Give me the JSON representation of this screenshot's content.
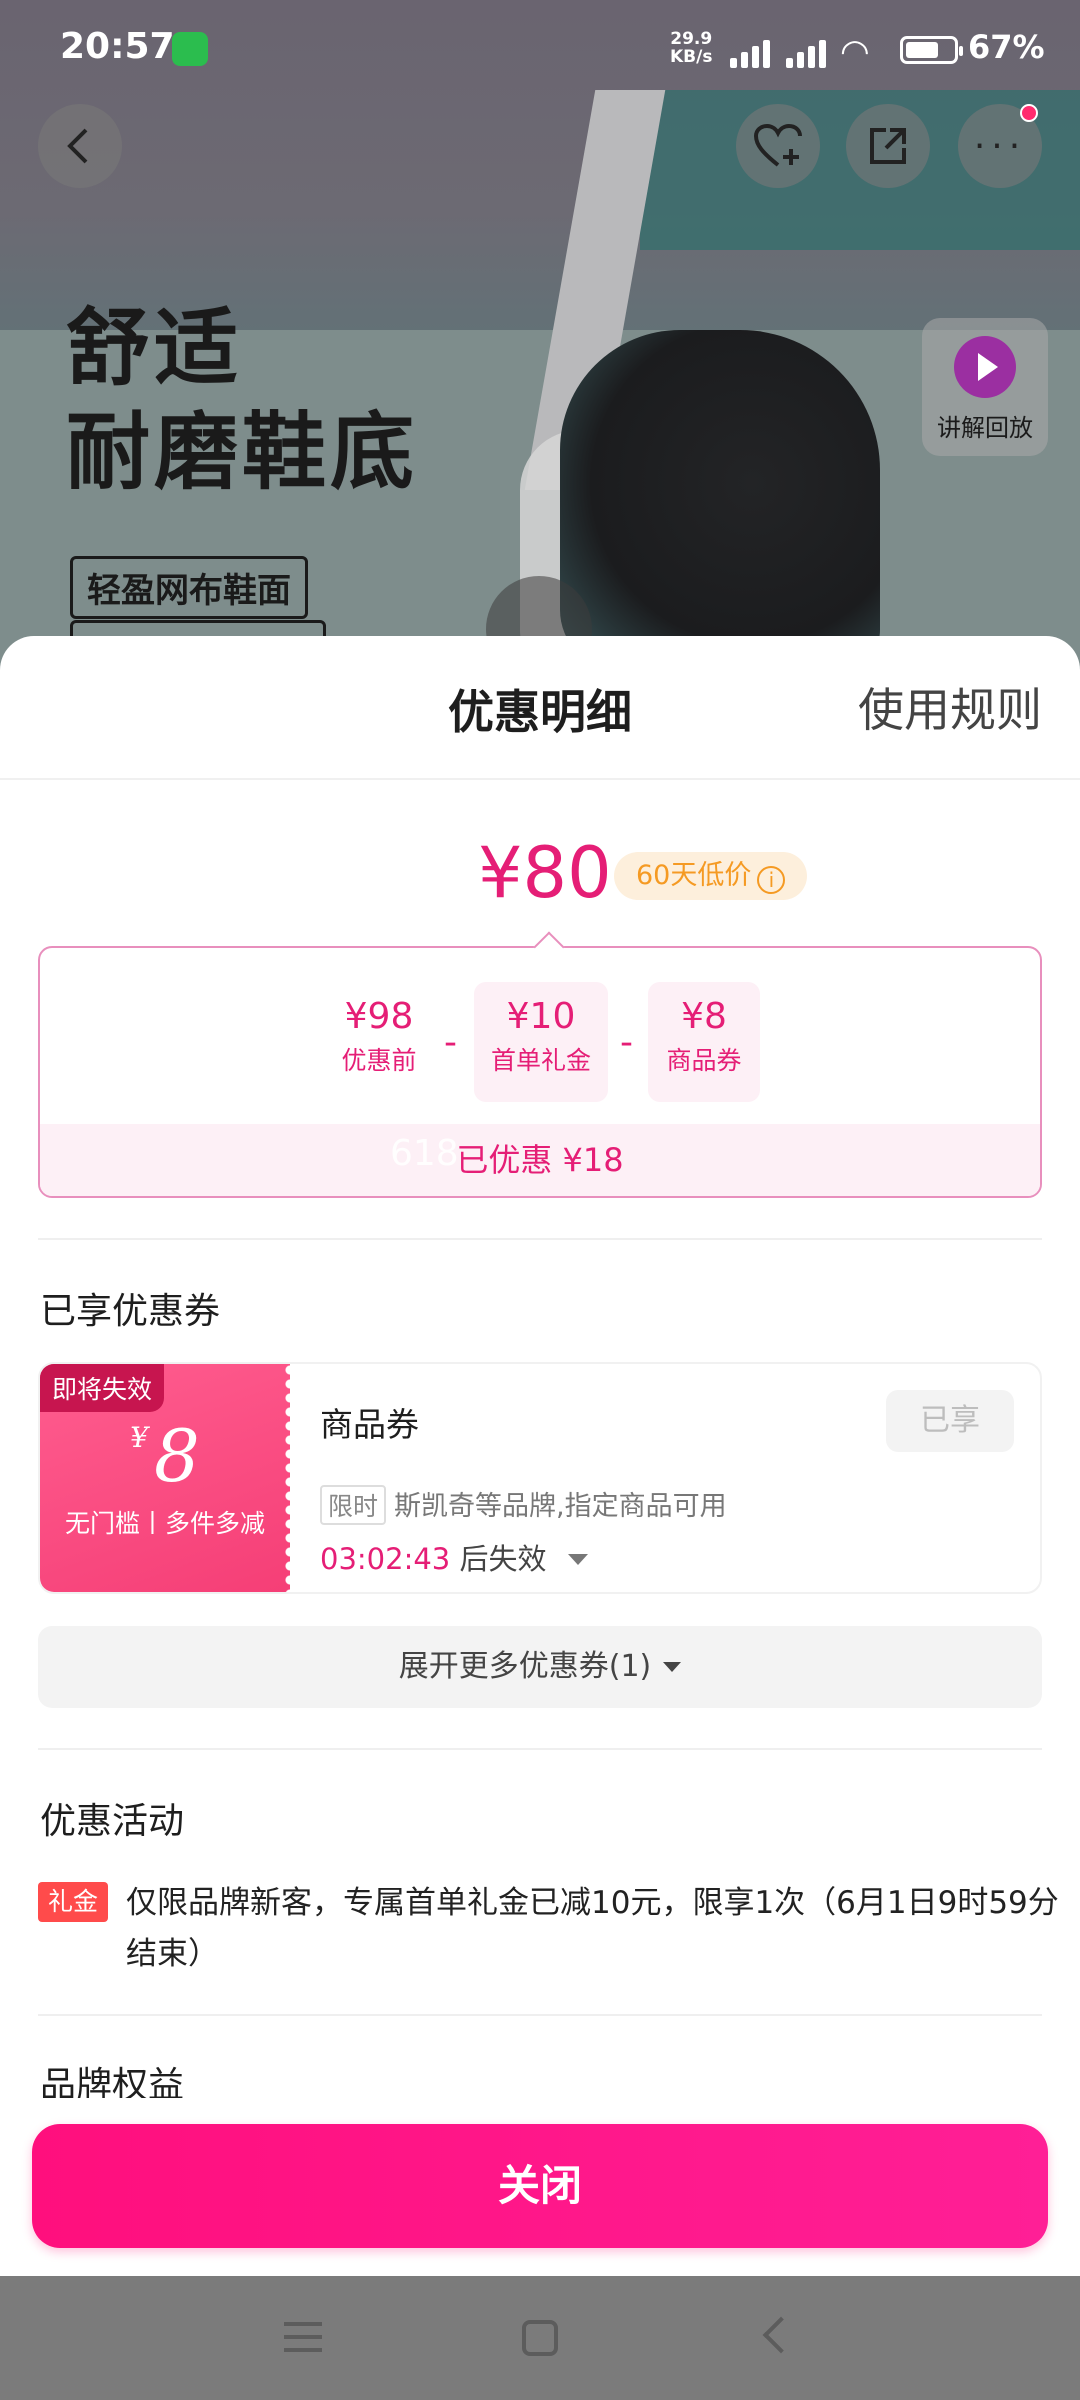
{
  "status_bar": {
    "time": "20:57",
    "net_speed_value": "29.9",
    "net_speed_unit": "KB/s",
    "battery": "67%"
  },
  "hero": {
    "headline_line1": "舒适",
    "headline_line2": "耐磨鞋底",
    "feature_tag": "轻盈网布鞋面",
    "replay_label": "讲解回放"
  },
  "sheet": {
    "title": "优惠明细",
    "rules_link": "使用规则",
    "final_price": "¥80",
    "low_price_badge": "60天低价",
    "breakdown": [
      {
        "value": "¥98",
        "label": "优惠前"
      },
      {
        "value": "¥10",
        "label": "首单礼金"
      },
      {
        "value": "¥8",
        "label": "商品券"
      }
    ],
    "minus_sign": "-",
    "saved_text": "已优惠 ¥18",
    "saved_overlay": "618"
  },
  "coupons_section": {
    "title": "已享优惠券",
    "coupon": {
      "expire_tag": "即将失效",
      "currency": "¥",
      "amount": "8",
      "condition": "无门槛丨多件多减",
      "name": "商品券",
      "status_button": "已享",
      "limit_tag": "限时",
      "description": "斯凯奇等品牌,指定商品可用",
      "countdown": "03:02:43",
      "countdown_suffix": "后失效"
    },
    "expand_label": "展开更多优惠券(1)"
  },
  "activity_section": {
    "title": "优惠活动",
    "badge": "礼金",
    "text": "仅限品牌新客，专属首单礼金已减10元，限享1次（6月1日9时59分结束）"
  },
  "brand_section": {
    "title": "品牌权益"
  },
  "close_button": "关闭",
  "colors": {
    "accent": "#e51e76",
    "button": "#ff0f7d",
    "badge_orange": "#f59a23"
  }
}
